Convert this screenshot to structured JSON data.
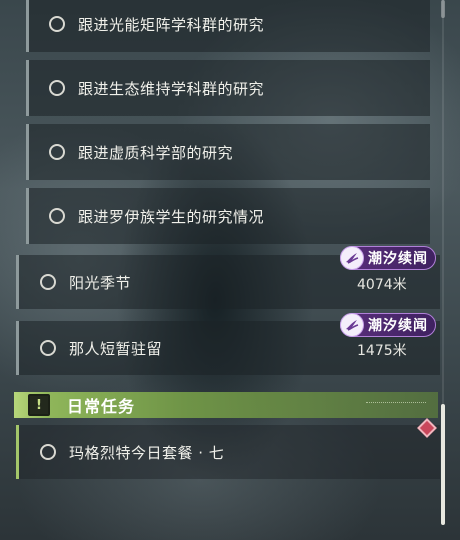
{
  "sub_quests": [
    {
      "title": "跟进光能矩阵学科群的研究"
    },
    {
      "title": "跟进生态维持学科群的研究"
    },
    {
      "title": "跟进虚质科学部的研究"
    },
    {
      "title": "跟进罗伊族学生的研究情况"
    }
  ],
  "main_quests": [
    {
      "title": "阳光季节",
      "badge": "潮汐续闻",
      "distance": "4074米"
    },
    {
      "title": "那人短暂驻留",
      "badge": "潮汐续闻",
      "distance": "1475米"
    }
  ],
  "daily": {
    "section_title": "日常任务",
    "quest": {
      "title": "玛格烈特今日套餐 · 七"
    }
  },
  "colors": {
    "badge_purple": "#5a2f7c",
    "daily_green": "#8fb65a",
    "marker_red": "#c9475b"
  },
  "icons": {
    "quest_status": "hollow-circle-icon",
    "badge": "tide-emblem-icon",
    "daily": "exclamation-box-icon",
    "tracker": "diamond-marker-icon"
  }
}
